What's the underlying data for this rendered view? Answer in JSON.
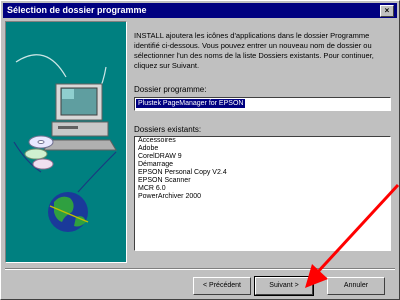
{
  "window": {
    "title": "Sélection de dossier programme",
    "close_symbol": "×"
  },
  "instructions": "INSTALL ajoutera les icônes d'applications dans le dossier Programme identifié ci-dessous. Vous pouvez entrer un nouveau nom de dossier ou sélectionner l'un des noms de la liste Dossiers existants. Pour continuer, cliquez sur Suivant.",
  "program_folder": {
    "label": "Dossier programme:",
    "value": "Plustek PageManager for EPSON"
  },
  "existing_folders": {
    "label": "Dossiers existants:",
    "items": [
      "Accessoires",
      "Adobe",
      "CorelDRAW 9",
      "Démarrage",
      "EPSON Personal Copy V2.4",
      "EPSON Scanner",
      "MCR 6.0",
      "PowerArchiver 2000"
    ]
  },
  "buttons": {
    "back": "< Précédent",
    "next": "Suivant >",
    "cancel": "Annuler"
  },
  "colors": {
    "titlebar": "#000080",
    "panel": "#008080",
    "arrow": "#ff0000"
  },
  "icons": [
    "computer-icon",
    "cd-discs-icon",
    "globe-icon",
    "arrow-icon"
  ]
}
